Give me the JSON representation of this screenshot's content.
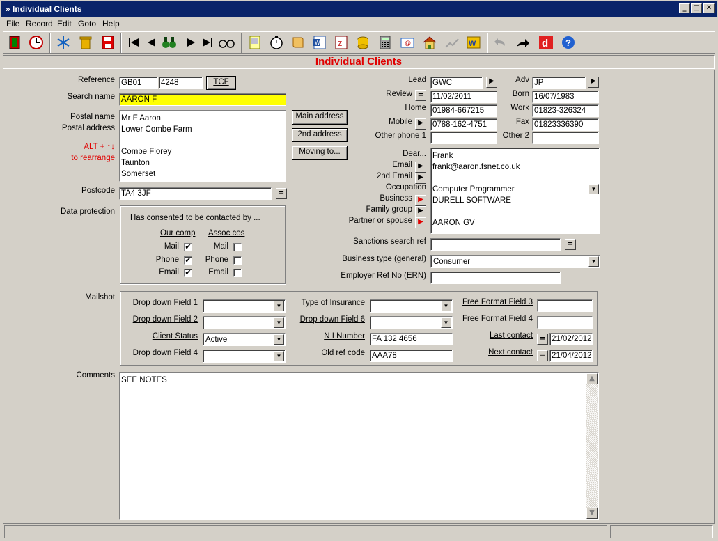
{
  "window": {
    "title": "Individual Clients"
  },
  "menu": [
    "File",
    "Record",
    "Edit",
    "Goto",
    "Help"
  ],
  "form_title": "Individual Clients",
  "left": {
    "reference_label": "Reference",
    "reference_code": "GB01",
    "reference_num": "4248",
    "tcf_button": "TCF",
    "search_name_label": "Search name",
    "search_name_value": "AARON F",
    "postal_name_label": "Postal name",
    "postal_address_label": "Postal address",
    "rearrange_hint_1": "ALT + ↑↓",
    "rearrange_hint_2": "to rearrange",
    "address_lines": [
      "Mr F Aaron",
      "Lower Combe Farm",
      "",
      "Combe Florey",
      "Taunton",
      "Somerset"
    ],
    "main_address_button": "Main address",
    "second_address_button": "2nd address",
    "moving_button": "Moving to...",
    "postcode_label": "Postcode",
    "postcode_value": "TA4 3JF",
    "data_protection_label": "Data protection",
    "consent_heading": "Has consented to be contacted by ...",
    "col_our_comp": "Our comp",
    "col_assoc_cos": "Assoc cos",
    "consent_rows": [
      {
        "label": "Mail",
        "our": "✔",
        "assoc": ""
      },
      {
        "label": "Phone",
        "our": "✔",
        "assoc": ""
      },
      {
        "label": "Email",
        "our": "✔",
        "assoc": ""
      }
    ]
  },
  "right": {
    "lead_label": "Lead",
    "lead_value": "GWC",
    "adv_label": "Adv",
    "adv_value": "JP",
    "review_label": "Review",
    "review_value": "11/02/2011",
    "born_label": "Born",
    "born_value": "16/07/1983",
    "home_label": "Home",
    "home_value": "01984-667215",
    "work_label": "Work",
    "work_value": "01823-326324",
    "mobile_label": "Mobile",
    "mobile_value": "0788-162-4751",
    "fax_label": "Fax",
    "fax_value": "01823336390",
    "other_phone1_label": "Other phone 1",
    "other_phone1_value": "",
    "other2_label": "Other 2",
    "other2_value": "",
    "dear_label": "Dear...",
    "email_label": "Email",
    "email2_label": "2nd Email",
    "occupation_label": "Occupation",
    "business_label": "Business",
    "family_group_label": "Family group",
    "partner_label": "Partner or spouse",
    "details_lines": [
      "Frank",
      "frank@aaron.fsnet.co.uk",
      "",
      "Computer Programmer",
      "DURELL SOFTWARE",
      "",
      "AARON GV"
    ],
    "sanctions_label": "Sanctions search ref",
    "sanctions_value": "",
    "business_type_label": "Business type (general)",
    "business_type_value": "Consumer",
    "employer_ref_label": "Employer Ref No (ERN)",
    "employer_ref_value": ""
  },
  "mailshot": {
    "label": "Mailshot",
    "dd1_label": "Drop down Field 1",
    "dd1_value": "",
    "dd2_label": "Drop down Field 2",
    "dd2_value": "",
    "status_label": "Client Status",
    "status_value": "Active",
    "dd4_label": "Drop down Field 4",
    "dd4_value": "",
    "insurance_label": "Type of Insurance",
    "insurance_value": "",
    "dd6_label": "Drop down Field 6",
    "dd6_value": "",
    "ni_label": "N I Number",
    "ni_value": "FA 132 4656",
    "oldref_label": "Old ref code",
    "oldref_value": "AAA78",
    "ff3_label": "Free Format Field 3",
    "ff3_value": "",
    "ff4_label": "Free Format Field 4",
    "ff4_value": "",
    "last_contact_label": "Last contact",
    "last_contact_value": "21/02/2012",
    "next_contact_label": "Next contact",
    "next_contact_value": "21/04/2012"
  },
  "comments": {
    "label": "Comments",
    "value": "SEE NOTES"
  },
  "colors": {
    "title_red": "#e00000",
    "titlebar": "#0a246a",
    "highlight": "#ffff00",
    "face": "#d4d0c8"
  }
}
